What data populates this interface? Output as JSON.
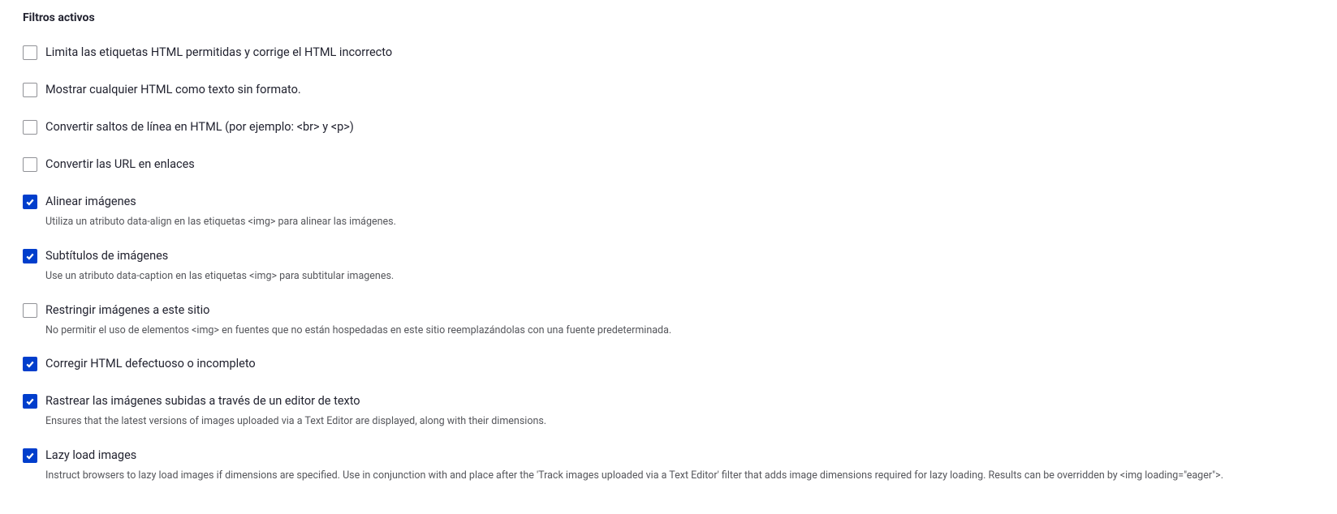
{
  "section_title": "Filtros activos",
  "filters": [
    {
      "checked": false,
      "label": "Limita las etiquetas HTML permitidas y corrige el HTML incorrecto",
      "description": null
    },
    {
      "checked": false,
      "label": "Mostrar cualquier HTML como texto sin formato.",
      "description": null
    },
    {
      "checked": false,
      "label": "Convertir saltos de línea en HTML (por ejemplo: <br> y <p>)",
      "description": null
    },
    {
      "checked": false,
      "label": "Convertir las URL en enlaces",
      "description": null
    },
    {
      "checked": true,
      "label": "Alinear imágenes",
      "description": "Utiliza un atributo data-align en las etiquetas <img> para alinear las imágenes."
    },
    {
      "checked": true,
      "label": "Subtítulos de imágenes",
      "description": "Use un atributo data-caption en las etiquetas <img> para subtitular imagenes."
    },
    {
      "checked": false,
      "label": "Restringir imágenes a este sitio",
      "description": "No permitir el uso de elementos <img> en fuentes que no están hospedadas en este sitio reemplazándolas con una fuente predeterminada."
    },
    {
      "checked": true,
      "label": "Corregir HTML defectuoso o incompleto",
      "description": null
    },
    {
      "checked": true,
      "label": "Rastrear las imágenes subidas a través de un editor de texto",
      "description": "Ensures that the latest versions of images uploaded via a Text Editor are displayed, along with their dimensions."
    },
    {
      "checked": true,
      "label": "Lazy load images",
      "description": "Instruct browsers to lazy load images if dimensions are specified. Use in conjunction with and place after the 'Track images uploaded via a Text Editor' filter that adds image dimensions required for lazy loading. Results can be overridden by <img loading=\"eager\">."
    }
  ]
}
